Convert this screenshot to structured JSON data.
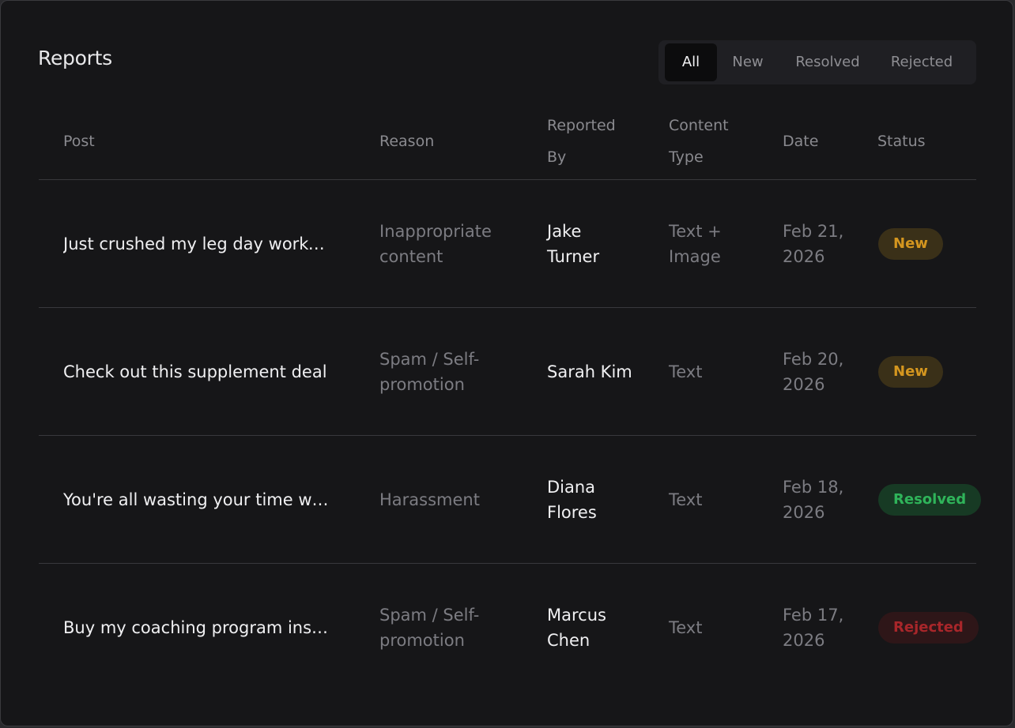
{
  "header": {
    "title": "Reports"
  },
  "filters": {
    "tabs": [
      "All",
      "New",
      "Resolved",
      "Rejected"
    ],
    "active": "All"
  },
  "table": {
    "columns": [
      "Post",
      "Reason",
      "Reported By",
      "Content Type",
      "Date",
      "Status"
    ],
    "rows": [
      {
        "post": "Just crushed my leg day workout today",
        "reason": "Inappropriate content",
        "reported_by": "Jake Turner",
        "content_type": "Text + Image",
        "date": "Feb 21, 2026",
        "status": "New"
      },
      {
        "post": "Check out this supplement deal",
        "reason": "Spam / Self-promotion",
        "reported_by": "Sarah Kim",
        "content_type": "Text",
        "date": "Feb 20, 2026",
        "status": "New"
      },
      {
        "post": "You're all wasting your time with this",
        "reason": "Harassment",
        "reported_by": "Diana Flores",
        "content_type": "Text",
        "date": "Feb 18, 2026",
        "status": "Resolved"
      },
      {
        "post": "Buy my coaching program instead",
        "reason": "Spam / Self-promotion",
        "reported_by": "Marcus Chen",
        "content_type": "Text",
        "date": "Feb 17, 2026",
        "status": "Rejected"
      }
    ]
  },
  "status_colors": {
    "New": {
      "text": "#d4961f",
      "bg": "#3a3018"
    },
    "Resolved": {
      "text": "#2fb45a",
      "bg": "#173a24"
    },
    "Rejected": {
      "text": "#a8262a",
      "bg": "#2e1618"
    }
  }
}
